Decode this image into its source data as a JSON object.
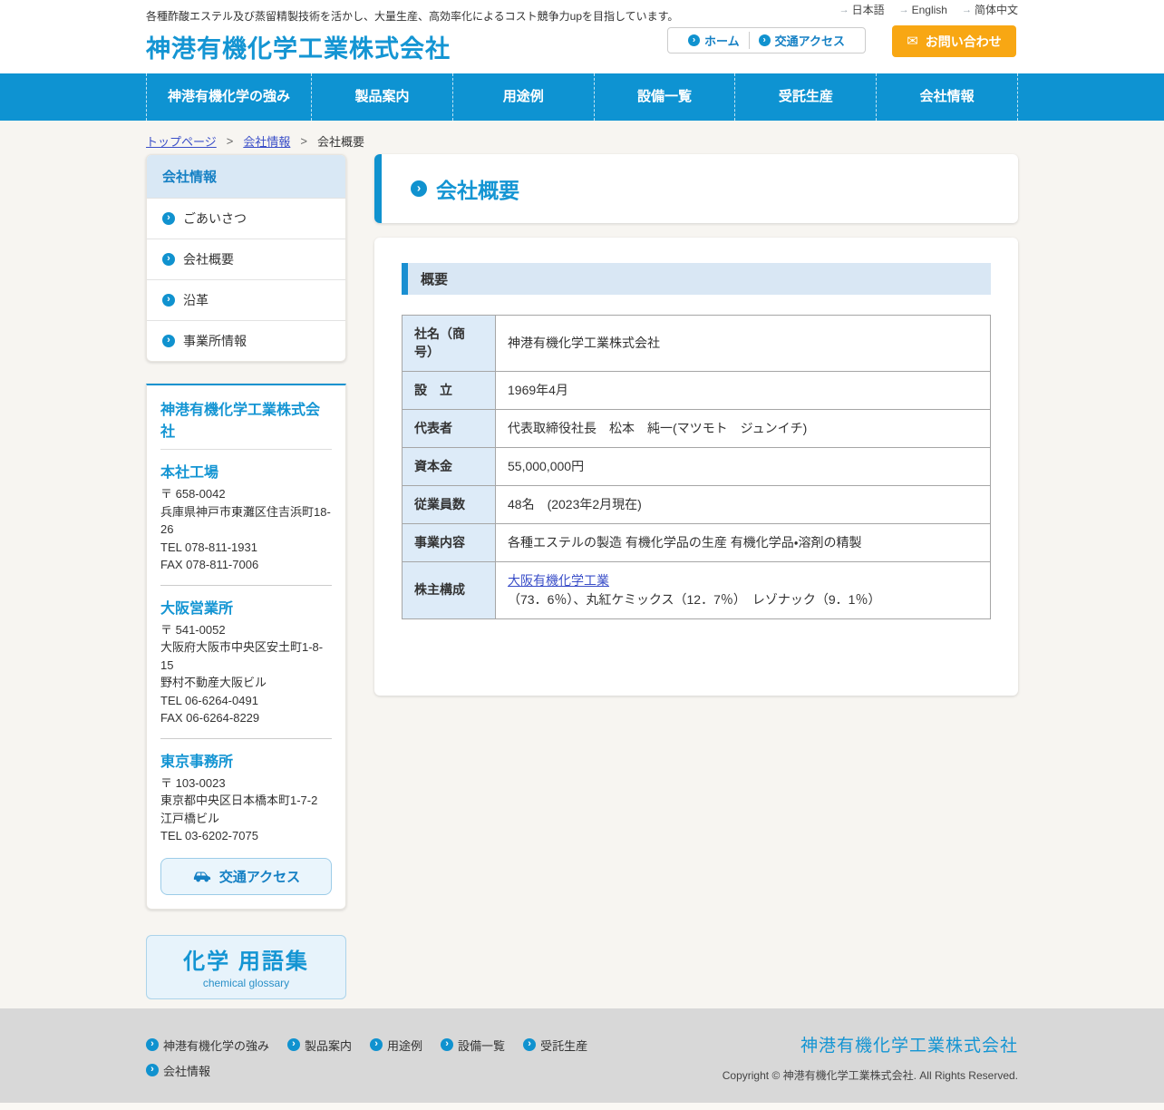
{
  "colors": {
    "primary_blue": "#0E93D2",
    "heading_blue": "#1495D3",
    "accent_orange": "#F8A713",
    "link_blue": "#3A4EC8",
    "light_blue_bg": "#DDEBF8"
  },
  "header": {
    "tagline": "各種酢酸エステル及び蒸留精製技術を活かし、大量生産、高効率化によるコスト競争力upを目指しています。",
    "site_title": "神港有機化学工業株式会社",
    "languages": [
      "日本語",
      "English",
      "简体中文"
    ],
    "quick_links": [
      "ホーム",
      "交通アクセス"
    ],
    "contact_label": "お問い合わせ"
  },
  "nav": {
    "items": [
      "神港有機化学の強み",
      "製品案内",
      "用途例",
      "設備一覧",
      "受託生産",
      "会社情報"
    ]
  },
  "breadcrumb": {
    "home": "トップページ",
    "section": "会社情報",
    "current": "会社概要",
    "separator": ">"
  },
  "sidebar": {
    "menu": {
      "title": "会社情報",
      "items": [
        "ごあいさつ",
        "会社概要",
        "沿革",
        "事業所情報"
      ]
    },
    "company": {
      "title": "神港有機化学工業株式会社",
      "offices": [
        {
          "name": "本社工場",
          "lines": [
            "〒 658-0042",
            "兵庫県神戸市東灘区住吉浜町18-26",
            "TEL 078-811-1931",
            "FAX 078-811-7006"
          ]
        },
        {
          "name": "大阪営業所",
          "lines": [
            "〒 541-0052",
            "大阪府大阪市中央区安土町1-8-15",
            "野村不動産大阪ビル",
            "TEL 06-6264-0491",
            "FAX 06-6264-8229"
          ]
        },
        {
          "name": "東京事務所",
          "lines": [
            "〒 103-0023",
            "東京都中央区日本橋本町1-7-2",
            "江戸橋ビル",
            "TEL 03-6202-7075"
          ]
        }
      ],
      "access_button": "交通アクセス"
    },
    "glossary": {
      "title": "化学 用語集",
      "subtitle": "chemical glossary"
    }
  },
  "main": {
    "page_title": "会社概要",
    "section_title": "概要",
    "table": {
      "rows": [
        {
          "label": "社名（商号）",
          "value": "神港有機化学工業株式会社"
        },
        {
          "label": "設　立",
          "value": "1969年4月"
        },
        {
          "label": "代表者",
          "value": "代表取締役社長　松本　純一(マツモト　ジュンイチ)"
        },
        {
          "label": "資本金",
          "value": "55,000,000円"
        },
        {
          "label": "従業員数",
          "value": "48名　(2023年2月現在)"
        },
        {
          "label": "事業内容",
          "value": "各種エステルの製造 有機化学品の生産 有機化学品・溶剤の精製"
        },
        {
          "label": "株主構成",
          "link": "大阪有機化学工業",
          "after": "（73．6％）、丸紅ケミックス（12．7％）　レゾナック（9．1％）"
        }
      ]
    }
  },
  "footer": {
    "nav_items": [
      "神港有機化学の強み",
      "製品案内",
      "用途例",
      "設備一覧",
      "受託生産",
      "会社情報"
    ],
    "company_name": "神港有機化学工業株式会社",
    "copyright": "Copyright © 神港有機化学工業株式会社. All Rights Reserved."
  }
}
